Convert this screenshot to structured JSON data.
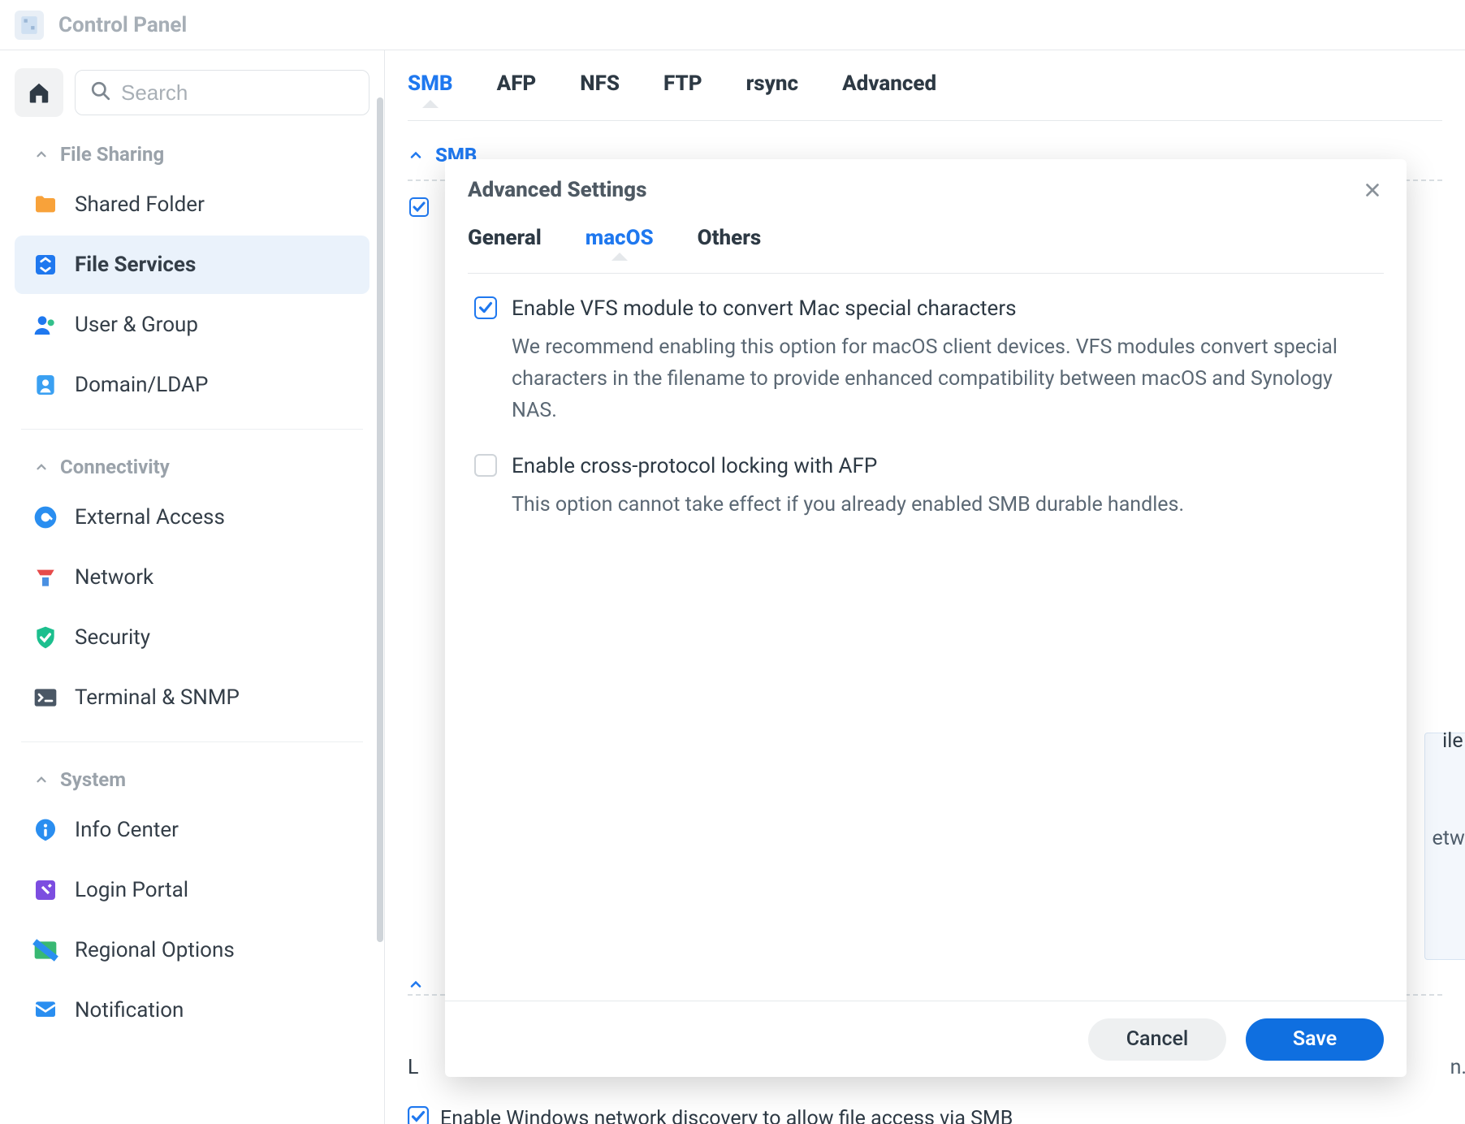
{
  "app": {
    "title": "Control Panel"
  },
  "search": {
    "placeholder": "Search"
  },
  "sidebar": {
    "sections": [
      {
        "label": "File Sharing",
        "items": [
          {
            "label": "Shared Folder"
          },
          {
            "label": "File Services"
          },
          {
            "label": "User & Group"
          },
          {
            "label": "Domain/LDAP"
          }
        ]
      },
      {
        "label": "Connectivity",
        "items": [
          {
            "label": "External Access"
          },
          {
            "label": "Network"
          },
          {
            "label": "Security"
          },
          {
            "label": "Terminal & SNMP"
          }
        ]
      },
      {
        "label": "System",
        "items": [
          {
            "label": "Info Center"
          },
          {
            "label": "Login Portal"
          },
          {
            "label": "Regional Options"
          },
          {
            "label": "Notification"
          }
        ]
      }
    ]
  },
  "main": {
    "tabs": [
      "SMB",
      "AFP",
      "NFS",
      "FTP",
      "rsync",
      "Advanced"
    ],
    "active_tab": "SMB",
    "smb_section_label": "SMB",
    "peek_ile": "ile E",
    "peek_etwo": "etwo",
    "peek_n": "n.",
    "peek_L": "L",
    "bottom_checkbox_label": "Enable Windows network discovery to allow file access via SMB"
  },
  "modal": {
    "title": "Advanced Settings",
    "tabs": [
      "General",
      "macOS",
      "Others"
    ],
    "active_tab": "macOS",
    "options": [
      {
        "checked": true,
        "label": "Enable VFS module to convert Mac special characters",
        "desc": "We recommend enabling this option for macOS client devices. VFS modules convert special characters in the filename to provide enhanced compatibility between macOS and Synology NAS."
      },
      {
        "checked": false,
        "label": "Enable cross-protocol locking with AFP",
        "desc": "This option cannot take effect if you already enabled SMB durable handles."
      }
    ],
    "buttons": {
      "cancel": "Cancel",
      "save": "Save"
    }
  }
}
